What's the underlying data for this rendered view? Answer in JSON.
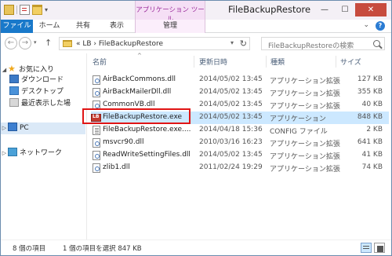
{
  "window": {
    "title": "FileBackupRestore",
    "context_tab_group": "アプリケーション ツール",
    "controls": {
      "minimize": "—",
      "maximize": "☐",
      "close": "✕"
    }
  },
  "ribbon": {
    "tabs": {
      "file": "ファイル",
      "home": "ホーム",
      "share": "共有",
      "view": "表示",
      "manage": "管理"
    },
    "expand_glyph": "⌄",
    "help_glyph": "?"
  },
  "nav": {
    "back_glyph": "←",
    "forward_glyph": "→",
    "dropdown_glyph": "▾",
    "up_glyph": "↑",
    "address_path": "« LB › FileBackupRestore",
    "address_dropdown_glyph": "▾",
    "refresh_glyph": "↻",
    "search_placeholder": "FileBackupRestoreの検索"
  },
  "sidebar": {
    "favorites": {
      "label": "お気に入り",
      "arrow": "◢",
      "icon": "star-icon",
      "glyph": "★"
    },
    "items": [
      {
        "label": "ダウンロード",
        "icon": "download-folder-icon"
      },
      {
        "label": "デスクトップ",
        "icon": "desktop-folder-icon"
      },
      {
        "label": "最近表示した場",
        "icon": "recent-places-icon"
      }
    ],
    "pc": {
      "label": "PC",
      "arrow": "▷",
      "icon": "pc-icon"
    },
    "network": {
      "label": "ネットワーク",
      "arrow": "▷",
      "icon": "network-icon"
    }
  },
  "file_list": {
    "columns": {
      "name": "名前",
      "date": "更新日時",
      "type": "種類",
      "size": "サイズ"
    },
    "sort_glyph": "^",
    "rows": [
      {
        "name": "AirBackCommons.dll",
        "date": "2014/05/02 13:45",
        "type": "アプリケーション拡張",
        "size": "127 KB",
        "icon": "dll-file-icon"
      },
      {
        "name": "AirBackMailerDll.dll",
        "date": "2014/05/02 13:45",
        "type": "アプリケーション拡張",
        "size": "355 KB",
        "icon": "dll-file-icon"
      },
      {
        "name": "CommonVB.dll",
        "date": "2014/05/02 13:45",
        "type": "アプリケーション拡張",
        "size": "40 KB",
        "icon": "dll-file-icon"
      },
      {
        "name": "FileBackupRestore.exe",
        "date": "2014/05/02 13:45",
        "type": "アプリケーション",
        "size": "848 KB",
        "icon": "exe-file-icon",
        "selected": true
      },
      {
        "name": "FileBackupRestore.exe....",
        "date": "2014/04/18 15:36",
        "type": "CONFIG ファイル",
        "size": "2 KB",
        "icon": "config-file-icon"
      },
      {
        "name": "msvcr90.dll",
        "date": "2010/03/16 16:23",
        "type": "アプリケーション拡張",
        "size": "641 KB",
        "icon": "dll-file-icon"
      },
      {
        "name": "ReadWriteSettingFiles.dll",
        "date": "2014/05/02 13:45",
        "type": "アプリケーション拡張",
        "size": "41 KB",
        "icon": "dll-file-icon"
      },
      {
        "name": "zlib1.dll",
        "date": "2011/02/24 19:29",
        "type": "アプリケーション拡張",
        "size": "74 KB",
        "icon": "dll-file-icon"
      }
    ]
  },
  "status": {
    "item_count": "8 個の項目",
    "selection": "1 個の項目を選択  847 KB"
  },
  "colors": {
    "file_tab": "#1979ca",
    "context_tab": "#f5dff5",
    "context_text": "#9b2b9b",
    "selection": "#cce8ff",
    "highlight_box": "#e01515",
    "close_button": "#c74b3e"
  }
}
